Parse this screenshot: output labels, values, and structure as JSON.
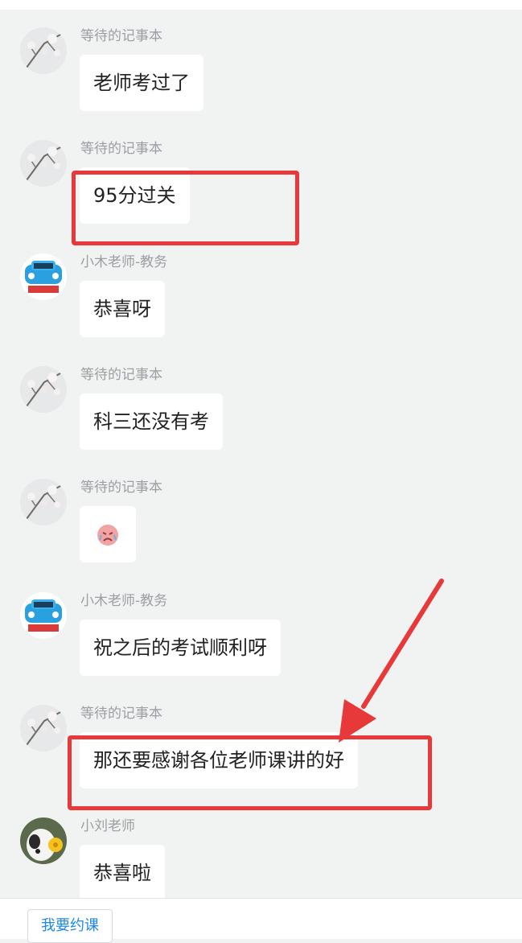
{
  "messages": [
    {
      "sender": "等待的记事本",
      "text": "老师考过了"
    },
    {
      "sender": "等待的记事本",
      "text": "95分过关"
    },
    {
      "sender": "小木老师-教务",
      "text": "恭喜呀"
    },
    {
      "sender": "等待的记事本",
      "text": "科三还没有考"
    },
    {
      "sender": "等待的记事本",
      "emoji": "crying-face-sticker"
    },
    {
      "sender": "小木老师-教务",
      "text": "祝之后的考试顺利呀"
    },
    {
      "sender": "等待的记事本",
      "text": "那还要感谢各位老师课讲的好"
    },
    {
      "sender": "小刘老师",
      "text": "恭喜啦"
    }
  ],
  "footer": {
    "book_button": "我要约课"
  },
  "colors": {
    "highlight": "#e8393a",
    "background": "#f1f3f3",
    "link": "#1e88e5"
  }
}
